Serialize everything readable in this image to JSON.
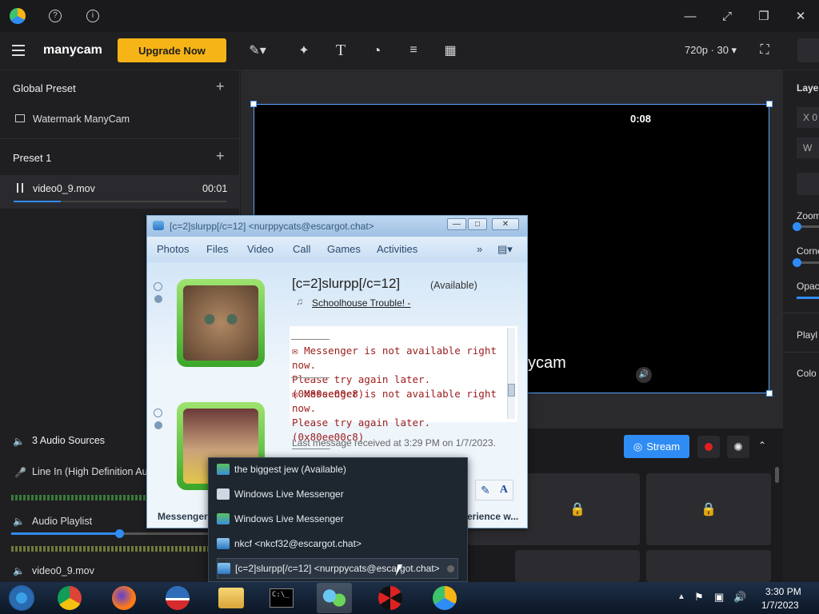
{
  "app": {
    "name": "manycam",
    "upgrade_label": "Upgrade Now",
    "resolution": "720p · 30"
  },
  "colors": {
    "accent": "#f7b416",
    "stream": "#2f8cf5",
    "record": "#e02020"
  },
  "left": {
    "global_preset": "Global Preset",
    "watermark": "Watermark ManyCam",
    "preset1": "Preset 1",
    "video_item": "video0_9.mov",
    "video_time": "00:01",
    "audio_sources": "3 Audio Sources",
    "line_in": "Line In (High Definition Au",
    "audio_playlist": "Audio Playlist",
    "audio_video": "video0_9.mov"
  },
  "stage": {
    "timer": "0:08",
    "watermark_text": "ycam"
  },
  "right": {
    "layers": "Laye",
    "x": "X",
    "x_val": "0",
    "w": "W",
    "zoom": "Zoom",
    "corner": "Corne",
    "opacity": "Opac",
    "playlist": "Playl",
    "color": "Colo"
  },
  "bottom": {
    "stream_label": "Stream"
  },
  "msn": {
    "title": "[c=2]slurpp[/c=12] <nurppycats@escargot.chat>",
    "menu": [
      "Photos",
      "Files",
      "Video",
      "Call",
      "Games",
      "Activities"
    ],
    "contact_name": "[c=2]slurpp[/c=12]",
    "status": "(Available)",
    "song": "Schoolhouse Trouble! -",
    "msg1_a": "Messenger is not available right now.",
    "msg1_b": "Please try again later. (0x80ee00c8)",
    "msg2_a": "Messenger is not available right now.",
    "msg2_b": "Please try again later. (0x80ee00c8)",
    "last_received": "Last message received at 3:29 PM on 1/7/2023.",
    "footer_left": "Messenger",
    "footer_right": "erience w..."
  },
  "jumplist": {
    "items": [
      "the biggest jew (Available)",
      "Windows Live Messenger",
      "Windows Live Messenger",
      "nkcf <nkcf32@escargot.chat>",
      "[c=2]slurpp[/c=12] <nurppycats@escargot.chat>"
    ]
  },
  "taskbar": {
    "time": "3:30 PM",
    "date": "1/7/2023"
  }
}
